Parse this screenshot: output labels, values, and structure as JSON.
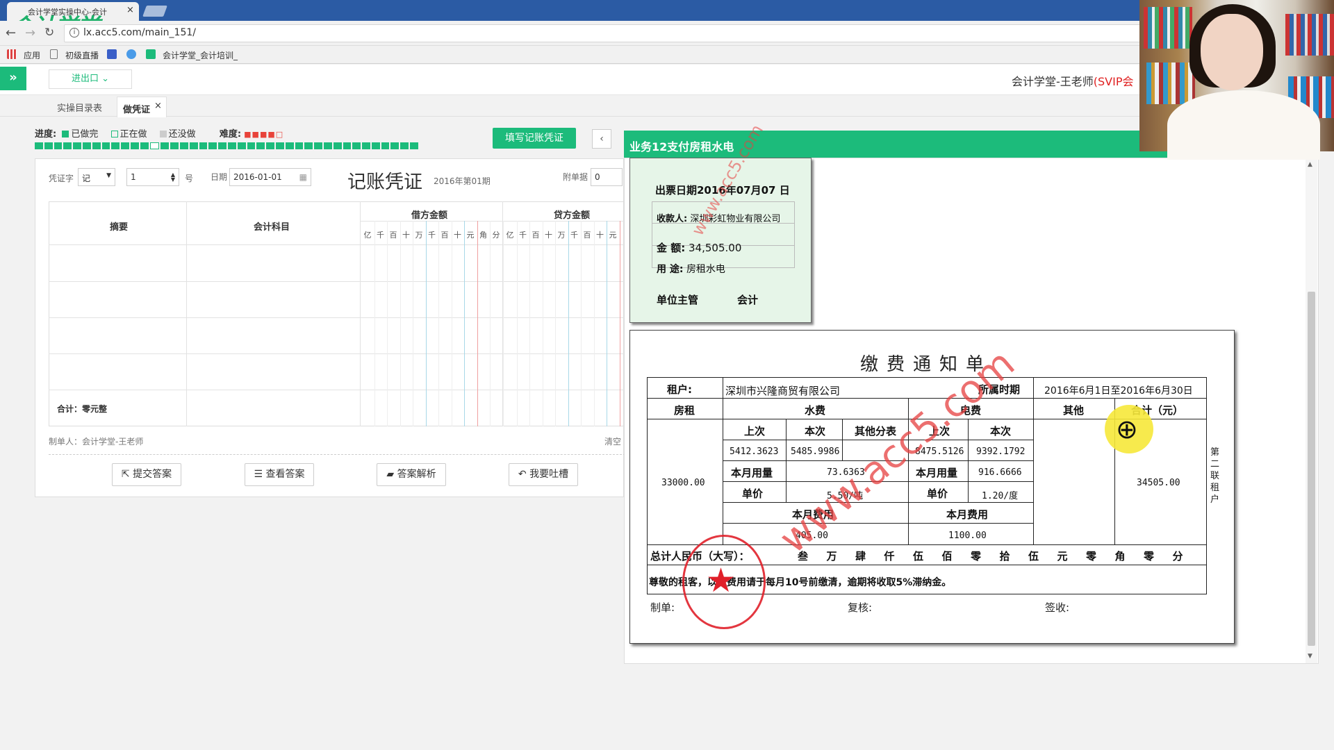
{
  "browser": {
    "tab_title": "会计学堂实操中心-会计",
    "logo": "会计学堂",
    "url": "lx.acc5.com/main_151/",
    "bookmarks": [
      "应用",
      "初级直播",
      "会计学堂_会计培训_"
    ]
  },
  "app": {
    "import_export": "进出口",
    "user_name": "会计学堂-王老师",
    "user_level": "(SVIP会",
    "tabs": [
      "实操目录表",
      "做凭证"
    ]
  },
  "progress": {
    "label": "进度:",
    "done": "已做完",
    "doing": "正在做",
    "todo": "还没做",
    "difficulty_label": "难度:",
    "difficulty_stars": 4,
    "total_segments": 40,
    "current_segment": 12,
    "fill_button": "填写记账凭证",
    "prev_icon": "chevron-left-icon"
  },
  "voucher": {
    "type_label": "凭证字",
    "type_value": "记",
    "number": "1",
    "number_suffix": "号",
    "date_label": "日期",
    "date_value": "2016-01-01",
    "title": "记账凭证",
    "period": "2016年第01期",
    "attach_label": "附单据",
    "attach_value": "0",
    "col_summary": "摘要",
    "col_account": "会计科目",
    "col_debit": "借方金额",
    "col_credit": "贷方金额",
    "digits": [
      "亿",
      "千",
      "百",
      "十",
      "万",
      "千",
      "百",
      "十",
      "元",
      "角",
      "分"
    ],
    "total": "合计：零元整",
    "maker": "制单人：会计学堂-王老师",
    "clear": "清空",
    "buttons": [
      "提交答案",
      "查看答案",
      "答案解析",
      "我要吐槽"
    ]
  },
  "business": {
    "header": "业务12支付房租水电",
    "stub": {
      "date_line": "出票日期2016年07月07 日",
      "payee_label": "收款人:",
      "payee": "深圳彩虹物业有限公司",
      "amount_label": "金    额:",
      "amount": "34,505.00",
      "purpose_label": "用    途:",
      "purpose": "房租水电",
      "manager": "单位主管",
      "accountant": "会计"
    },
    "notice": {
      "title": "缴费通知单",
      "tenant_label": "租户:",
      "tenant": "深圳市兴隆商贸有限公司",
      "period_label": "所属时期",
      "period": "2016年6月1日至2016年6月30日",
      "h_rent": "房租",
      "h_water": "水费",
      "h_power": "电费",
      "h_other": "其他",
      "h_total": "合计（元）",
      "prev": "上次",
      "curr": "本次",
      "other_share": "其他分表",
      "water_prev": "5412.3623",
      "water_curr": "5485.9986",
      "power_prev": "8475.5126",
      "power_curr": "9392.1792",
      "usage_label": "本月用量",
      "water_usage": "73.6363",
      "power_usage": "916.6666",
      "price_label": "单价",
      "water_price": "5.50/吨",
      "power_price": "1.20/度",
      "fee_label": "本月费用",
      "water_fee": "405.00",
      "power_fee": "1100.00",
      "rent": "33000.00",
      "total": "34505.00",
      "total_caps_label": "总计人民币（大写）：",
      "total_caps": [
        "叁",
        "万",
        "肆",
        "仟",
        "伍",
        "佰",
        "零",
        "拾",
        "伍",
        "元",
        "零",
        "角",
        "零",
        "分"
      ],
      "note": "尊敬的租客，以上费用请于每月10号前缴清，逾期将收取5%滞纳金。",
      "side": "第二联租户",
      "maker": "制单:",
      "review": "复核:",
      "sign": "签收:"
    },
    "watermark": "www.acc5.com"
  },
  "colors": {
    "accent": "#1cbb7b",
    "browser_blue": "#2b5ba4",
    "stamp_red": "#e0202a"
  }
}
